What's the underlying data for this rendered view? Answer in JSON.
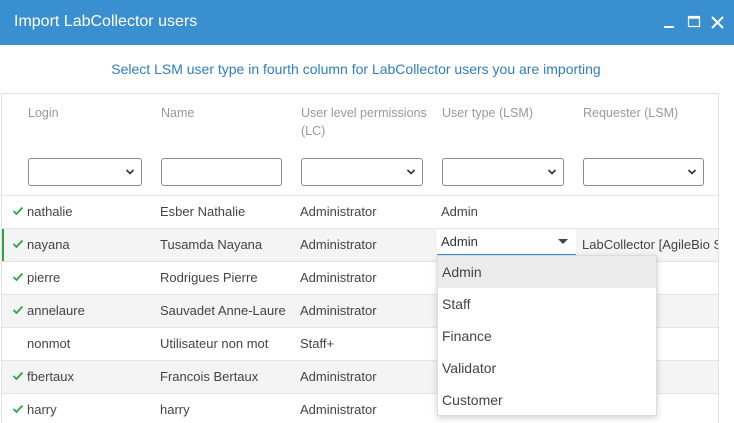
{
  "window": {
    "title": "Import LabCollector users"
  },
  "subtitle": "Select LSM user type in fourth column for LabCollector users you are importing",
  "columns": [
    "Login",
    "Name",
    "User level permissions (LC)",
    "User type (LSM)",
    "Requester (LSM)"
  ],
  "rows": [
    {
      "checked": true,
      "login": "nathalie",
      "name": "Esber Nathalie",
      "level": "Administrator",
      "usertype": "Admin"
    },
    {
      "checked": true,
      "login": "nayana",
      "name": "Tusamda Nayana",
      "level": "Administrator",
      "usertype": "Admin",
      "requester": "LabCollector [AgileBio S"
    },
    {
      "checked": true,
      "login": "pierre",
      "name": "Rodrigues Pierre",
      "level": "Administrator"
    },
    {
      "checked": true,
      "login": "annelaure",
      "name": "Sauvadet Anne-Laure",
      "level": "Administrator"
    },
    {
      "checked": false,
      "login": "nonmot",
      "name": "Utilisateur non mot",
      "level": "Staff+"
    },
    {
      "checked": true,
      "login": "fbertaux",
      "name": "Francois Bertaux",
      "level": "Administrator"
    },
    {
      "checked": true,
      "login": "harry",
      "name": "harry",
      "level": "Administrator"
    }
  ],
  "dropdown_options": [
    "Admin",
    "Staff",
    "Finance",
    "Validator",
    "Customer"
  ],
  "colors": {
    "titlebar": "#3a8fd0",
    "accent": "#2f7ec0",
    "check": "#27a744"
  }
}
